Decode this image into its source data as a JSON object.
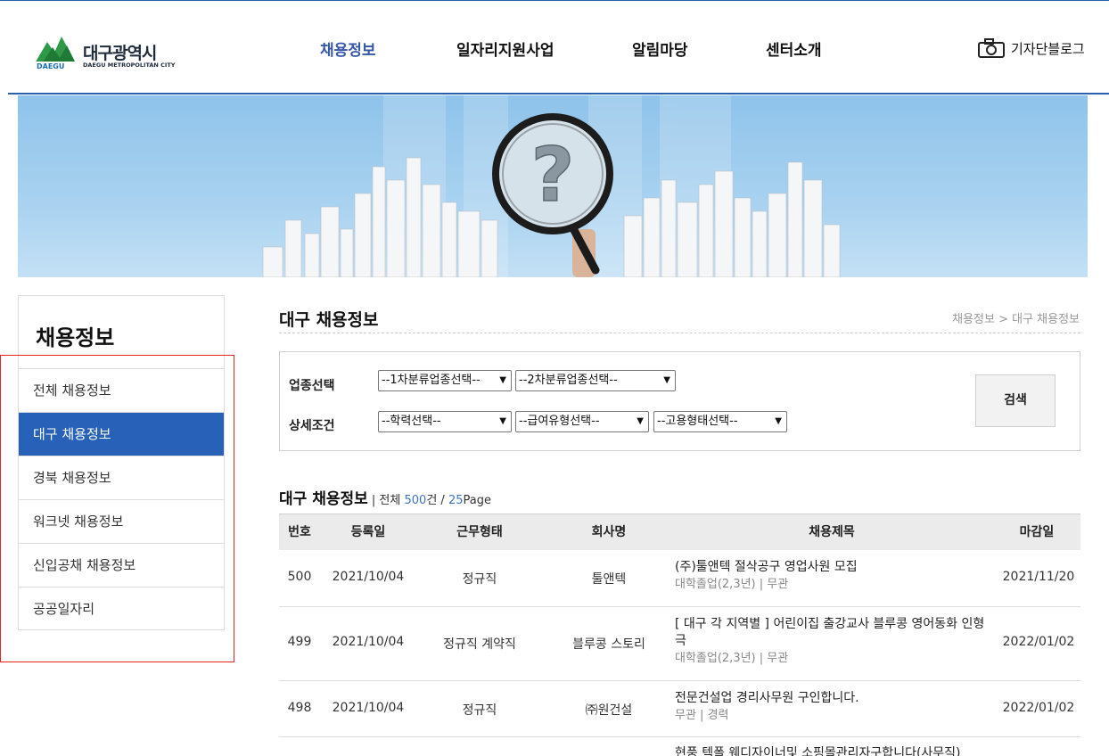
{
  "header": {
    "logo": {
      "korean": "대구광역시",
      "english": "DAEGU METROPOLITAN CITY",
      "badge": "DAEGU"
    },
    "nav": [
      "채용정보",
      "일자리지원사업",
      "알림마당",
      "센터소개"
    ],
    "blog_label": "기자단블로그",
    "blog_icon": "camera-icon",
    "accent": "#2a5fab"
  },
  "banner": {
    "description_icon": "magnifier-question-icon"
  },
  "sidebar": {
    "title": "채용정보",
    "items": [
      "전체 채용정보",
      "대구 채용정보",
      "경북 채용정보",
      "워크넷 채용정보",
      "신입공채 채용정보",
      "공공일자리"
    ],
    "active_index": 1,
    "active_color": "#2762b8"
  },
  "content": {
    "title": "대구 채용정보",
    "breadcrumb": "채용정보 > 대구 채용정보"
  },
  "search": {
    "industry_label": "업종선택",
    "detail_label": "상세조건",
    "selects": {
      "cat1": "--1차분류업종선택--",
      "cat2": "--2차분류업종선택--",
      "education": "--학력선택--",
      "salary": "--급여유형선택--",
      "employment": "--고용형태선택--"
    },
    "button": "검색"
  },
  "list": {
    "title": "대구 채용정보",
    "sep": " | ",
    "total_prefix": "전체 ",
    "total": "500",
    "total_unit": "건",
    "page_sep": " / ",
    "pages": "25",
    "pages_unit": "Page",
    "columns": [
      "번호",
      "등록일",
      "근무형태",
      "회사명",
      "채용제목",
      "마감일"
    ],
    "rows": [
      {
        "no": "500",
        "date": "2021/10/04",
        "type": "정규직",
        "company": "툴앤텍",
        "title": "(주)툴앤텍 절삭공구 영업사원 모집",
        "sub": "대학졸업(2,3년) | 무관",
        "deadline": "2021/11/20"
      },
      {
        "no": "499",
        "date": "2021/10/04",
        "type": "정규직 계약직",
        "company": "블루콩 스토리",
        "title": "[ 대구 각 지역별 ] 어린이집 출강교사 블루콩 영어동화 인형극",
        "sub": "대학졸업(2,3년) | 무관",
        "deadline": "2022/01/02"
      },
      {
        "no": "498",
        "date": "2021/10/04",
        "type": "정규직",
        "company": "㈜원건설",
        "title": "전문건설업 경리사무원 구인합니다.",
        "sub": "무관 | 경력",
        "deadline": "2022/01/02"
      },
      {
        "no": "",
        "date": "",
        "type": "",
        "company": "",
        "title": "현풍 텍폴 웨디자이너및 소핑몰관리자구합니다(사무직)",
        "sub": "",
        "deadline": ""
      }
    ]
  }
}
